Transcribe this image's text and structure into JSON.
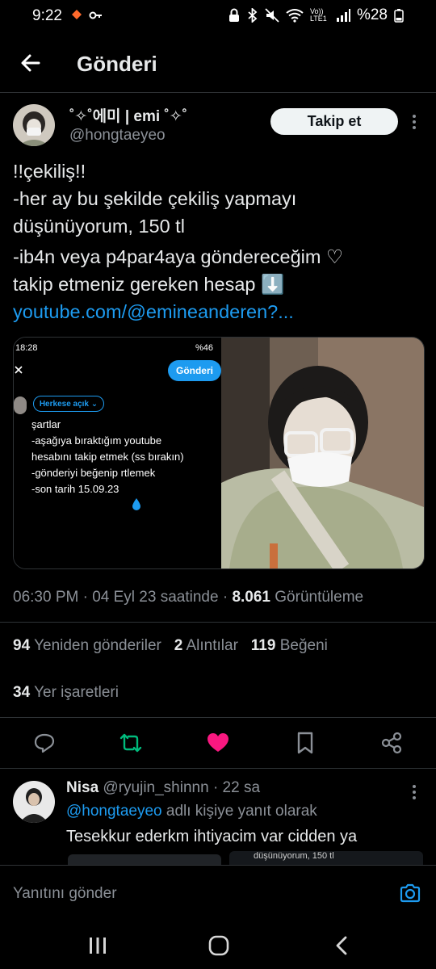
{
  "status_bar": {
    "time": "9:22",
    "volte": "Vo)) LTE1",
    "battery": "%28"
  },
  "header": {
    "title": "Gönderi"
  },
  "tweet": {
    "author_name": "˚✧˚에미 | emi ˚✧˚",
    "author_handle": "@hongtaeyeo",
    "follow_label": "Takip et",
    "lines": [
      "!!çekiliş!!",
      "-her ay bu şekilde çekiliş yapmayı",
      "düşünüyorum, 150 tl",
      "-ib4n veya p4par4aya göndereceğim ♡",
      "takip etmeniz gereken hesap ⬇️"
    ],
    "link": "youtube.com/@emineanderen?...",
    "screenshot": {
      "time": "18:28",
      "battery": "%46",
      "send_label": "Gönderi",
      "audience": "Herkese açık",
      "lines": [
        "şartlar",
        "-aşağıya bıraktığım youtube",
        "hesabını takip etmek (ss bırakın)",
        "-gönderiyi beğenip rtlemek",
        "-son tarih 15.09.23"
      ]
    },
    "timestamp": "06:30 PM · 04 Eyl 23 saatinde ·",
    "views_count": "8.061",
    "views_label": "Görüntüleme",
    "retweets_count": "94",
    "retweets_label": "Yeniden gönderiler",
    "quotes_count": "2",
    "quotes_label": "Alıntılar",
    "likes_count": "119",
    "likes_label": "Beğeni",
    "bookmarks_count": "34",
    "bookmarks_label": "Yer işaretleri"
  },
  "reply": {
    "name": "Nisa",
    "handle": "@ryujin_shinnn",
    "time": "· 22 sa",
    "reply_to_handle": "@hongtaeyeo",
    "reply_to_suffix": "adlı kişiye yanıt olarak",
    "text": "Tesekkur ederkm ihtiyacim var cidden ya",
    "preview_text": "düşünüyorum, 150 tl"
  },
  "compose": {
    "placeholder": "Yanıtını gönder"
  },
  "colors": {
    "accent": "#1d9bf0",
    "like": "#f91880",
    "retweet": "#00ba7c",
    "muted": "#8b9097"
  }
}
